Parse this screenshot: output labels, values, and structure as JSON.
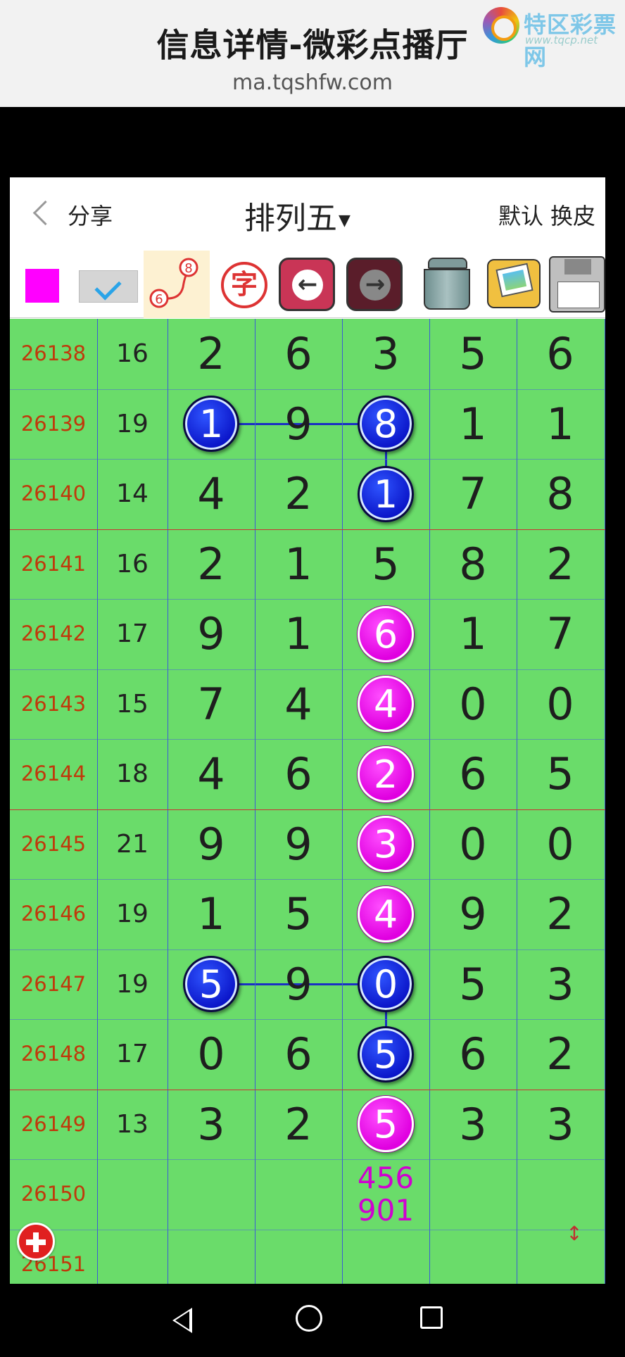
{
  "banner": {
    "title": "信息详情-微彩点播厅",
    "url": "ma.tqshfw.com",
    "logo_name": "特区彩票网",
    "logo_url": "www.tqcp.net"
  },
  "header": {
    "share_label": "分享",
    "title": "排列五",
    "default_label": "默认",
    "skin_label": "换皮"
  },
  "toolbar": {
    "zi_label": "字",
    "trend_icon_numbers": [
      "8",
      "6"
    ],
    "left_arrow": "←",
    "right_arrow": "→",
    "colors": {
      "magenta": "#ff00ff",
      "grid": "#6adc6a"
    }
  },
  "rows": [
    {
      "issue": "26138",
      "sum": "16",
      "digits": [
        "2",
        "6",
        "3",
        "5",
        "6"
      ]
    },
    {
      "issue": "26139",
      "sum": "19",
      "digits": [
        "1",
        "9",
        "8",
        "1",
        "1"
      ]
    },
    {
      "issue": "26140",
      "sum": "14",
      "digits": [
        "4",
        "2",
        "1",
        "7",
        "8"
      ]
    },
    {
      "issue": "26141",
      "sum": "16",
      "digits": [
        "2",
        "1",
        "5",
        "8",
        "2"
      ]
    },
    {
      "issue": "26142",
      "sum": "17",
      "digits": [
        "9",
        "1",
        "6",
        "1",
        "7"
      ]
    },
    {
      "issue": "26143",
      "sum": "15",
      "digits": [
        "7",
        "4",
        "4",
        "0",
        "0"
      ]
    },
    {
      "issue": "26144",
      "sum": "18",
      "digits": [
        "4",
        "6",
        "2",
        "6",
        "5"
      ]
    },
    {
      "issue": "26145",
      "sum": "21",
      "digits": [
        "9",
        "9",
        "3",
        "0",
        "0"
      ]
    },
    {
      "issue": "26146",
      "sum": "19",
      "digits": [
        "1",
        "5",
        "4",
        "9",
        "2"
      ]
    },
    {
      "issue": "26147",
      "sum": "19",
      "digits": [
        "5",
        "9",
        "0",
        "5",
        "3"
      ]
    },
    {
      "issue": "26148",
      "sum": "17",
      "digits": [
        "0",
        "6",
        "5",
        "6",
        "2"
      ]
    },
    {
      "issue": "26149",
      "sum": "13",
      "digits": [
        "3",
        "2",
        "5",
        "3",
        "3"
      ]
    },
    {
      "issue": "26150",
      "sum": "",
      "digits": [
        "",
        "",
        "",
        "",
        ""
      ]
    },
    {
      "issue": "26151",
      "sum": "",
      "digits": [
        "",
        "",
        "",
        "",
        ""
      ]
    }
  ],
  "highlights": [
    {
      "row": 1,
      "col": 0,
      "color": "blue"
    },
    {
      "row": 1,
      "col": 2,
      "color": "blue"
    },
    {
      "row": 2,
      "col": 2,
      "color": "blue"
    },
    {
      "row": 4,
      "col": 2,
      "color": "magenta"
    },
    {
      "row": 5,
      "col": 2,
      "color": "magenta"
    },
    {
      "row": 6,
      "col": 2,
      "color": "magenta"
    },
    {
      "row": 7,
      "col": 2,
      "color": "magenta"
    },
    {
      "row": 8,
      "col": 2,
      "color": "magenta"
    },
    {
      "row": 9,
      "col": 0,
      "color": "blue"
    },
    {
      "row": 9,
      "col": 2,
      "color": "blue"
    },
    {
      "row": 10,
      "col": 2,
      "color": "blue"
    },
    {
      "row": 11,
      "col": 2,
      "color": "magenta"
    }
  ],
  "prediction": {
    "line1": "456",
    "line2": "901"
  }
}
